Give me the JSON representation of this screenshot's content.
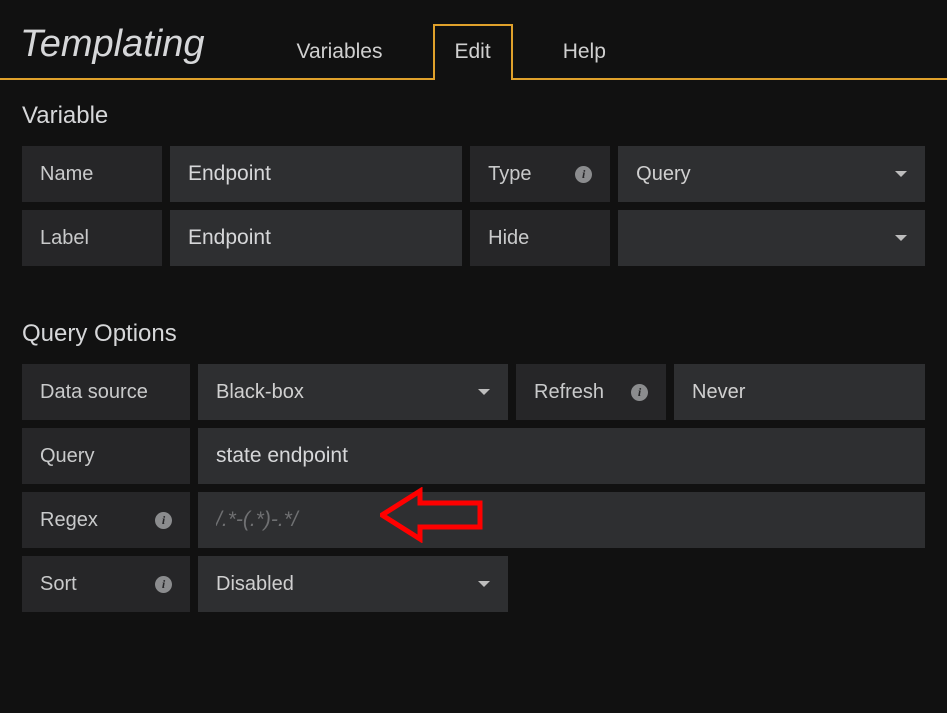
{
  "header": {
    "title": "Templating"
  },
  "tabs": {
    "variables": "Variables",
    "edit": "Edit",
    "help": "Help"
  },
  "variable_section": {
    "title": "Variable",
    "name_label": "Name",
    "name_value": "Endpoint",
    "type_label": "Type",
    "type_value": "Query",
    "label_label": "Label",
    "label_value": "Endpoint",
    "hide_label": "Hide",
    "hide_value": ""
  },
  "query_section": {
    "title": "Query Options",
    "datasource_label": "Data source",
    "datasource_value": "Black-box",
    "refresh_label": "Refresh",
    "refresh_value": "Never",
    "query_label": "Query",
    "query_value": "state endpoint",
    "regex_label": "Regex",
    "regex_placeholder": "/.*-(.*)-.*/",
    "regex_value": "",
    "sort_label": "Sort",
    "sort_value": "Disabled"
  }
}
